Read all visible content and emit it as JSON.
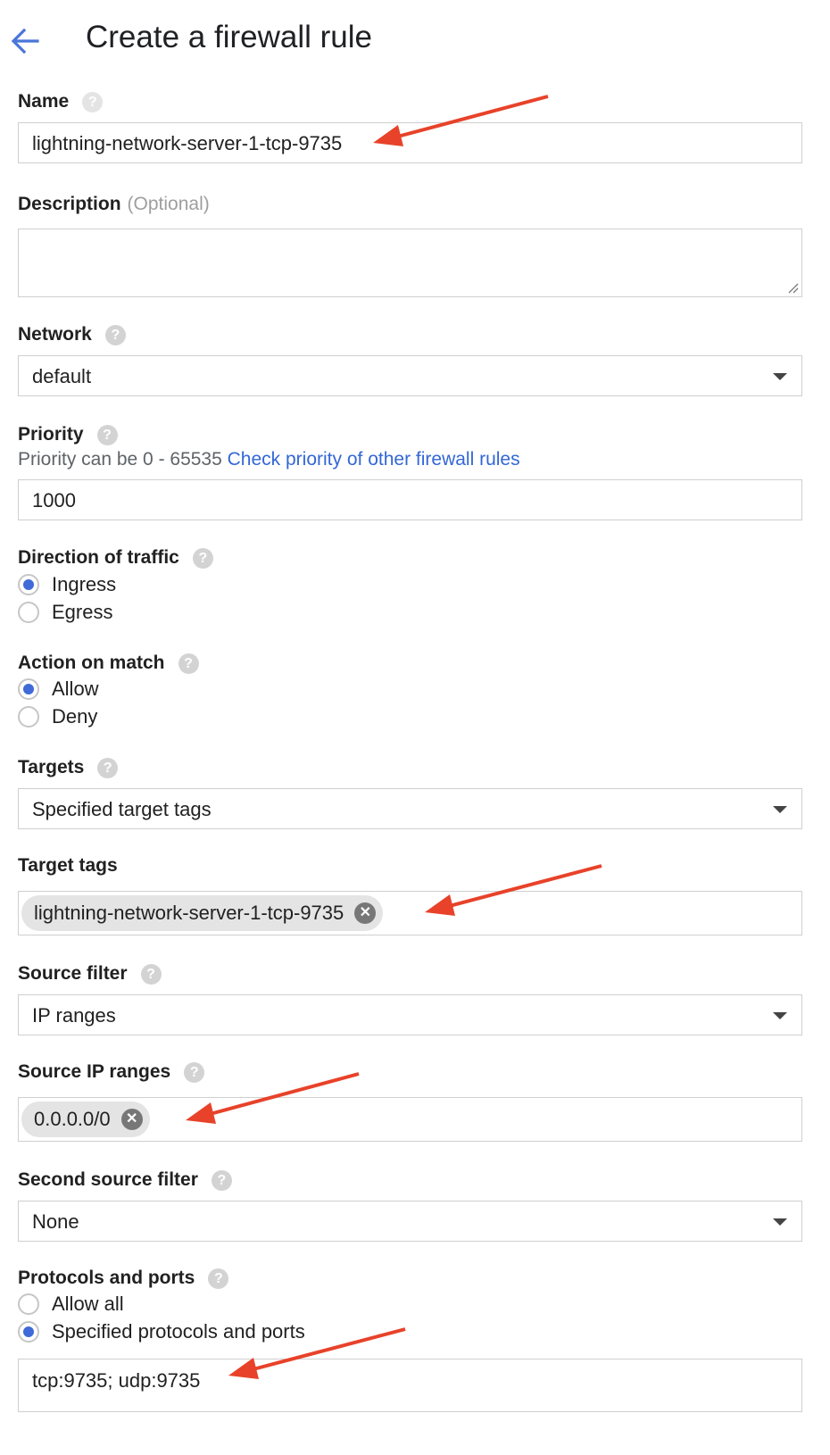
{
  "header": {
    "back_icon": "arrow-back-icon",
    "title": "Create a firewall rule"
  },
  "name": {
    "label": "Name",
    "value": "lightning-network-server-1-tcp-9735"
  },
  "description": {
    "label": "Description",
    "optional": "(Optional)",
    "value": ""
  },
  "network": {
    "label": "Network",
    "value": "default"
  },
  "priority": {
    "label": "Priority",
    "hint_text": "Priority can be 0 - 65535",
    "hint_link": "Check priority of other firewall rules",
    "value": "1000"
  },
  "direction": {
    "label": "Direction of traffic",
    "options": [
      "Ingress",
      "Egress"
    ],
    "selected": "Ingress"
  },
  "action": {
    "label": "Action on match",
    "options": [
      "Allow",
      "Deny"
    ],
    "selected": "Allow"
  },
  "targets": {
    "label": "Targets",
    "value": "Specified target tags"
  },
  "target_tags": {
    "label": "Target tags",
    "chips": [
      "lightning-network-server-1-tcp-9735"
    ]
  },
  "source_filter": {
    "label": "Source filter",
    "value": "IP ranges"
  },
  "source_ip_ranges": {
    "label": "Source IP ranges",
    "chips": [
      "0.0.0.0/0"
    ]
  },
  "second_source_filter": {
    "label": "Second source filter",
    "value": "None"
  },
  "protocols": {
    "label": "Protocols and ports",
    "options": [
      "Allow all",
      "Specified protocols and ports"
    ],
    "selected": "Specified protocols and ports",
    "value": "tcp:9735; udp:9735"
  },
  "colors": {
    "accent": "#3f6ad8",
    "link": "#3367d6",
    "annotation_arrow": "#e8422a"
  },
  "icons": {
    "help": "help-icon",
    "dropdown": "chevron-down-icon",
    "chip_remove": "close-circle-icon"
  }
}
